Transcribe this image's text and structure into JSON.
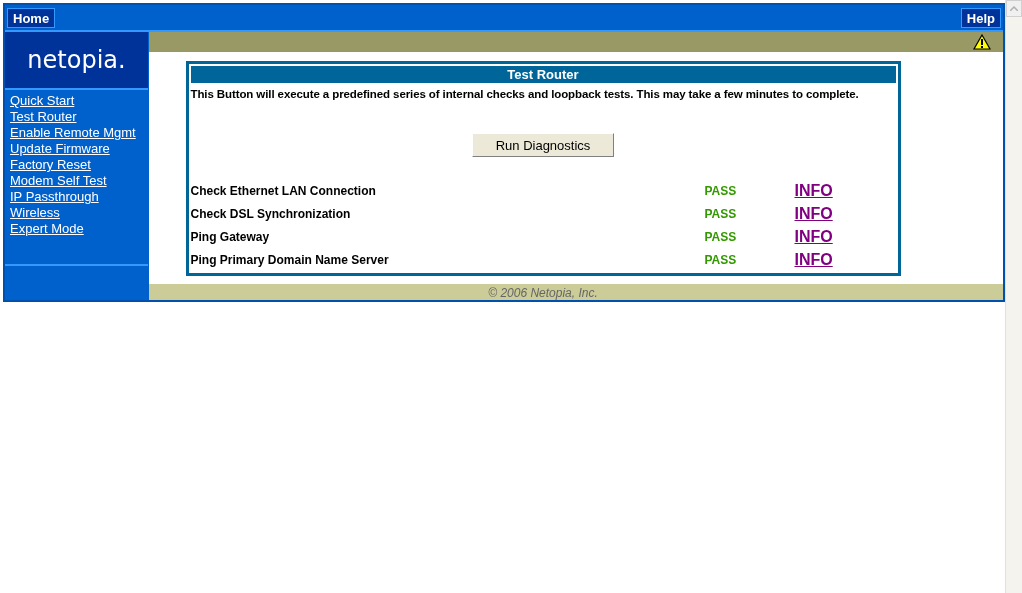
{
  "top_bar": {
    "home": "Home",
    "help": "Help"
  },
  "logo": "netopia.",
  "sidebar": {
    "items": [
      {
        "label": "Quick Start"
      },
      {
        "label": "Test Router"
      },
      {
        "label": "Enable Remote Mgmt"
      },
      {
        "label": "Update Firmware"
      },
      {
        "label": "Factory Reset"
      },
      {
        "label": "Modem Self Test"
      },
      {
        "label": "IP Passthrough"
      },
      {
        "label": "Wireless"
      },
      {
        "label": "Expert Mode"
      }
    ]
  },
  "panel": {
    "title": "Test Router",
    "description": "This Button will execute a predefined series of internal checks and loopback tests. This may take a few minutes to complete.",
    "button": "Run Diagnostics",
    "tests": [
      {
        "name": "Check Ethernet LAN Connection",
        "result": "PASS",
        "link": "INFO"
      },
      {
        "name": "Check DSL Synchronization",
        "result": "PASS",
        "link": "INFO"
      },
      {
        "name": "Ping Gateway",
        "result": "PASS",
        "link": "INFO"
      },
      {
        "name": "Ping Primary Domain Name Server",
        "result": "PASS",
        "link": "INFO"
      }
    ]
  },
  "footer": "© 2006 Netopia, Inc."
}
